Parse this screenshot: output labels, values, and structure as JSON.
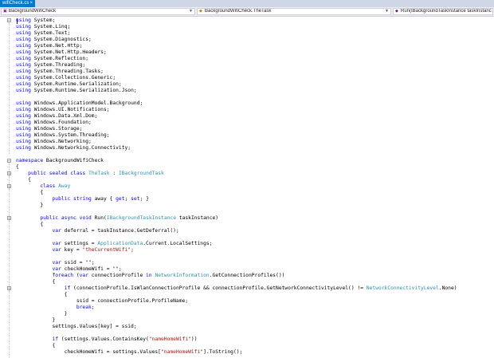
{
  "tab": {
    "label": "wifiCheck.cs",
    "close": "×"
  },
  "navbar": {
    "project": "BackgroundWifiCheck",
    "type": "BackgroundWifiCheck.TheTask",
    "member": "Run(IBackgroundTaskInstance taskInstanc"
  },
  "colors": {
    "keyword": "#0000ff",
    "type": "#2b91af",
    "string": "#a31515",
    "tab_active": "#007acc"
  },
  "icons": {
    "collapse": "minus-box-icon",
    "class": "class-icon",
    "method": "method-icon"
  },
  "code_lines": [
    [
      {
        "t": "using",
        "c": "kw"
      },
      {
        "t": " System;"
      }
    ],
    [
      {
        "t": "using",
        "c": "kw"
      },
      {
        "t": " System.Linq;"
      }
    ],
    [
      {
        "t": "using",
        "c": "kw"
      },
      {
        "t": " System.Text;"
      }
    ],
    [
      {
        "t": "using",
        "c": "kw"
      },
      {
        "t": " System.Diagnostics;"
      }
    ],
    [
      {
        "t": "using",
        "c": "kw"
      },
      {
        "t": " System.Net.Http;"
      }
    ],
    [
      {
        "t": "using",
        "c": "kw"
      },
      {
        "t": " System.Net.Http.Headers;"
      }
    ],
    [
      {
        "t": "using",
        "c": "kw"
      },
      {
        "t": " System.Reflection;"
      }
    ],
    [
      {
        "t": "using",
        "c": "kw"
      },
      {
        "t": " System.Threading;"
      }
    ],
    [
      {
        "t": "using",
        "c": "kw"
      },
      {
        "t": " System.Threading.Tasks;"
      }
    ],
    [
      {
        "t": "using",
        "c": "kw"
      },
      {
        "t": " System.Collections.Generic;"
      }
    ],
    [
      {
        "t": "using",
        "c": "kw"
      },
      {
        "t": " System.Runtime.Serialization;"
      }
    ],
    [
      {
        "t": "using",
        "c": "kw"
      },
      {
        "t": " System.Runtime.Serialization.Json;"
      }
    ],
    [
      {
        "t": ""
      }
    ],
    [
      {
        "t": "using",
        "c": "kw"
      },
      {
        "t": " Windows.ApplicationModel.Background;"
      }
    ],
    [
      {
        "t": "using",
        "c": "kw"
      },
      {
        "t": " Windows.UI.Notifications;"
      }
    ],
    [
      {
        "t": "using",
        "c": "kw"
      },
      {
        "t": " Windows.Data.Xml.Dom;"
      }
    ],
    [
      {
        "t": "using",
        "c": "kw"
      },
      {
        "t": " Windows.Foundation;"
      }
    ],
    [
      {
        "t": "using",
        "c": "kw"
      },
      {
        "t": " Windows.Storage;"
      }
    ],
    [
      {
        "t": "using",
        "c": "kw"
      },
      {
        "t": " Windows.System.Threading;"
      }
    ],
    [
      {
        "t": "using",
        "c": "kw"
      },
      {
        "t": " Windows.Networking;"
      }
    ],
    [
      {
        "t": "using",
        "c": "kw"
      },
      {
        "t": " Windows.Networking.Connectivity;"
      }
    ],
    [
      {
        "t": ""
      }
    ],
    [
      {
        "t": "namespace",
        "c": "kw"
      },
      {
        "t": " BackgroundWifiCheck"
      }
    ],
    [
      {
        "t": "{"
      }
    ],
    [
      {
        "t": "    "
      },
      {
        "t": "public",
        "c": "kw"
      },
      {
        "t": " "
      },
      {
        "t": "sealed",
        "c": "kw"
      },
      {
        "t": " "
      },
      {
        "t": "class",
        "c": "kw"
      },
      {
        "t": " "
      },
      {
        "t": "TheTask",
        "c": "ty"
      },
      {
        "t": " : "
      },
      {
        "t": "IBackgroundTask",
        "c": "ty"
      }
    ],
    [
      {
        "t": "    {"
      }
    ],
    [
      {
        "t": "        "
      },
      {
        "t": "class",
        "c": "kw"
      },
      {
        "t": " "
      },
      {
        "t": "Away",
        "c": "ty"
      }
    ],
    [
      {
        "t": "        {"
      }
    ],
    [
      {
        "t": "            "
      },
      {
        "t": "public",
        "c": "kw"
      },
      {
        "t": " "
      },
      {
        "t": "string",
        "c": "kw"
      },
      {
        "t": " away { "
      },
      {
        "t": "get",
        "c": "kw"
      },
      {
        "t": "; "
      },
      {
        "t": "set",
        "c": "kw"
      },
      {
        "t": "; }"
      }
    ],
    [
      {
        "t": "        }"
      }
    ],
    [
      {
        "t": ""
      }
    ],
    [
      {
        "t": "        "
      },
      {
        "t": "public",
        "c": "kw"
      },
      {
        "t": " "
      },
      {
        "t": "async",
        "c": "kw"
      },
      {
        "t": " "
      },
      {
        "t": "void",
        "c": "kw"
      },
      {
        "t": " Run("
      },
      {
        "t": "IBackgroundTaskInstance",
        "c": "ty"
      },
      {
        "t": " taskInstance)"
      }
    ],
    [
      {
        "t": "        {"
      }
    ],
    [
      {
        "t": "            "
      },
      {
        "t": "var",
        "c": "kw"
      },
      {
        "t": " deferral = taskInstance.GetDeferral();"
      }
    ],
    [
      {
        "t": ""
      }
    ],
    [
      {
        "t": "            "
      },
      {
        "t": "var",
        "c": "kw"
      },
      {
        "t": " settings = "
      },
      {
        "t": "ApplicationData",
        "c": "ty"
      },
      {
        "t": ".Current.LocalSettings;"
      }
    ],
    [
      {
        "t": "            "
      },
      {
        "t": "var",
        "c": "kw"
      },
      {
        "t": " key = "
      },
      {
        "t": "\"theCurrentWifi\"",
        "c": "st"
      },
      {
        "t": ";"
      }
    ],
    [
      {
        "t": ""
      }
    ],
    [
      {
        "t": "            "
      },
      {
        "t": "var",
        "c": "kw"
      },
      {
        "t": " ssid = "
      },
      {
        "t": "\"\"",
        "c": "st"
      },
      {
        "t": ";"
      }
    ],
    [
      {
        "t": "            "
      },
      {
        "t": "var",
        "c": "kw"
      },
      {
        "t": " checkHomeWifi = "
      },
      {
        "t": "\"\"",
        "c": "st"
      },
      {
        "t": ";"
      }
    ],
    [
      {
        "t": "            "
      },
      {
        "t": "foreach",
        "c": "kw"
      },
      {
        "t": " ("
      },
      {
        "t": "var",
        "c": "kw"
      },
      {
        "t": " connectionProfile "
      },
      {
        "t": "in",
        "c": "kw"
      },
      {
        "t": " "
      },
      {
        "t": "NetworkInformation",
        "c": "ty"
      },
      {
        "t": ".GetConnectionProfiles())"
      }
    ],
    [
      {
        "t": "            {"
      }
    ],
    [
      {
        "t": "                "
      },
      {
        "t": "if",
        "c": "kw"
      },
      {
        "t": " (connectionProfile.IsWlanConnectionProfile && connectionProfile.GetNetworkConnectivityLevel() != "
      },
      {
        "t": "NetworkConnectivityLevel",
        "c": "ty"
      },
      {
        "t": ".None)"
      }
    ],
    [
      {
        "t": "                {"
      }
    ],
    [
      {
        "t": "                    ssid = connectionProfile.ProfileName;"
      }
    ],
    [
      {
        "t": "                    "
      },
      {
        "t": "break",
        "c": "kw"
      },
      {
        "t": ";"
      }
    ],
    [
      {
        "t": "                }"
      }
    ],
    [
      {
        "t": "            }"
      }
    ],
    [
      {
        "t": "            settings.Values[key] = ssid;"
      }
    ],
    [
      {
        "t": ""
      }
    ],
    [
      {
        "t": "            "
      },
      {
        "t": "if",
        "c": "kw"
      },
      {
        "t": " (settings.Values.ContainsKey("
      },
      {
        "t": "\"nameHomeWifi\"",
        "c": "st"
      },
      {
        "t": "))"
      }
    ],
    [
      {
        "t": "            {"
      }
    ],
    [
      {
        "t": "                checkHomeWifi = settings.Values["
      },
      {
        "t": "\"nameHomeWifi\"",
        "c": "st"
      },
      {
        "t": "].ToString();"
      }
    ]
  ]
}
